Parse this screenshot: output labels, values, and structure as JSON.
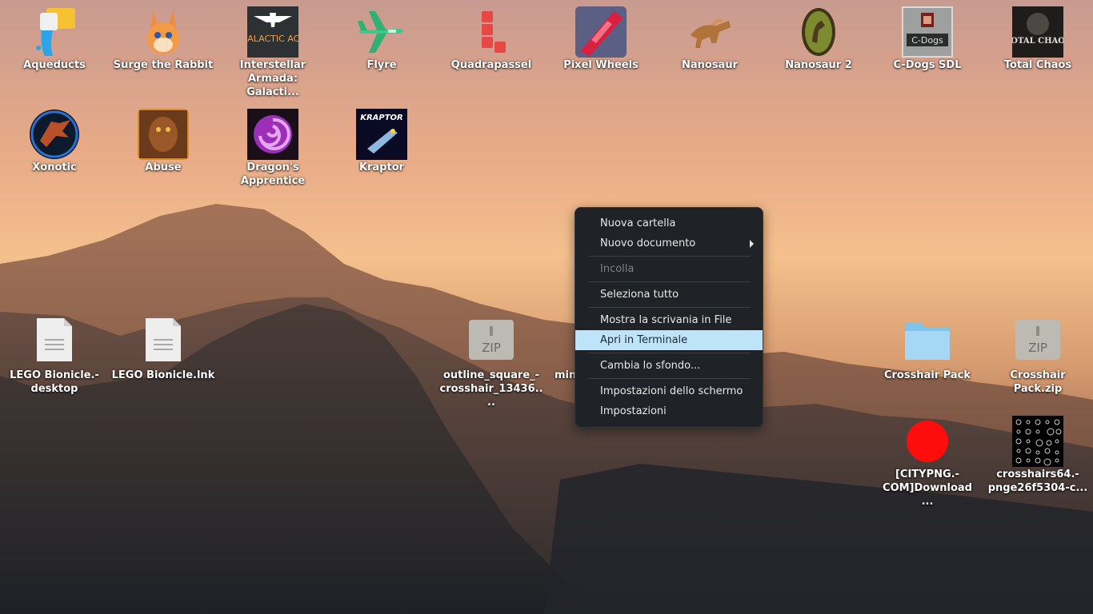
{
  "desktop": {
    "icons_row1": [
      {
        "id": "aqueducts",
        "label": "Aqueducts",
        "icon": "aqueducts-icon"
      },
      {
        "id": "surge",
        "label": "Surge the Rabbit",
        "icon": "rabbit-icon"
      },
      {
        "id": "armada",
        "label": "Interstellar Armada: Galacti...",
        "icon": "galactic-ace-icon",
        "logo": "GALACTIC ACE"
      },
      {
        "id": "flyre",
        "label": "Flyre",
        "icon": "flyre-plane-icon"
      },
      {
        "id": "quadrapassel",
        "label": "Quadrapassel",
        "icon": "tetromino-icon"
      },
      {
        "id": "pixelwheels",
        "label": "Pixel Wheels",
        "icon": "race-car-icon"
      },
      {
        "id": "nanosaur",
        "label": "Nanosaur",
        "icon": "dinosaur-icon"
      },
      {
        "id": "nanosaur2",
        "label": "Nanosaur 2",
        "icon": "dinosaur-egg-icon"
      },
      {
        "id": "cdogs",
        "label": "C-Dogs SDL",
        "icon": "c-dogs-icon",
        "logo": "C-Dogs"
      },
      {
        "id": "totalchaos",
        "label": "Total Chaos",
        "icon": "total-chaos-icon",
        "logo": "TOTAL CHAOS"
      }
    ],
    "icons_row2": [
      {
        "id": "xonotic",
        "label": "Xonotic",
        "icon": "xonotic-icon"
      },
      {
        "id": "abuse",
        "label": "Abuse",
        "icon": "abuse-icon"
      },
      {
        "id": "dragon",
        "label": "Dragon's Apprentice",
        "icon": "dragon-swirl-icon"
      },
      {
        "id": "kraptor",
        "label": "Kraptor",
        "icon": "kraptor-icon",
        "logo": "KRAPTOR"
      }
    ],
    "files": {
      "lego_desktop": {
        "label": "LEGO Bionicle.-desktop",
        "icon": "document-icon"
      },
      "lego_lnk": {
        "label": "LEGO Bionicle.lnk",
        "icon": "document-icon"
      },
      "outline_zip": {
        "label": "outline_square_-crosshair_13436....",
        "icon": "zip-archive-icon",
        "badge": "ZIP"
      },
      "mini": {
        "label": "mini",
        "icon": "hidden-file"
      },
      "crosshair_pack": {
        "label": "Crosshair Pack",
        "icon": "folder-icon"
      },
      "crosshair_zip": {
        "label": "Crosshair Pack.zip",
        "icon": "zip-archive-icon",
        "badge": "ZIP"
      },
      "citypng": {
        "label": "[CITYPNG.-COM]Download ...",
        "icon": "red-circle-image"
      },
      "crosshairs64": {
        "label": "crosshairs64.-pnge26f5304-c...",
        "icon": "crosshair-sheet-image"
      }
    }
  },
  "context_menu": {
    "items": [
      {
        "label": "Nuova cartella"
      },
      {
        "label": "Nuovo documento"
      },
      {
        "label": "Incolla"
      },
      {
        "label": "Seleziona tutto"
      },
      {
        "label": "Mostra la scrivania in File"
      },
      {
        "label": "Apri in Terminale"
      },
      {
        "label": "Cambia lo sfondo..."
      },
      {
        "label": "Impostazioni dello schermo"
      },
      {
        "label": "Impostazioni"
      }
    ]
  },
  "colors": {
    "menu_bg": "#1f2227",
    "menu_highlight": "#bde4f8",
    "folder": "#86cbf0"
  }
}
